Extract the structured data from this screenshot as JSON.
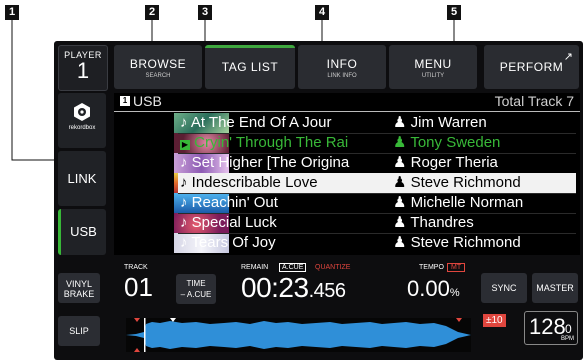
{
  "callouts": [
    "1",
    "2",
    "3",
    "4",
    "5"
  ],
  "player": {
    "label": "PLAYER",
    "number": "1"
  },
  "tabs": [
    {
      "label": "BROWSE",
      "sub": "SEARCH"
    },
    {
      "label": "TAG LIST",
      "sub": ""
    },
    {
      "label": "INFO",
      "sub": "LINK INFO"
    },
    {
      "label": "MENU",
      "sub": "UTILITY"
    }
  ],
  "perform_label": "PERFORM",
  "sources": {
    "rekordbox": "rekordbox",
    "link": "LINK",
    "usb": "USB"
  },
  "list": {
    "source_badge": "1",
    "source": "USB",
    "total": "Total Track 7",
    "rows": [
      {
        "title": "At The End Of A Jour",
        "artist": "Jim Warren",
        "state": "normal"
      },
      {
        "title": "Cryin' Through The Rai",
        "artist": "Tony Sweden",
        "state": "green"
      },
      {
        "title": "Set Higher [The Origina",
        "artist": "Roger Theria",
        "state": "normal"
      },
      {
        "title": "Indescribable Love",
        "artist": "Steve Richmond",
        "state": "selected"
      },
      {
        "title": "Reachin' Out",
        "artist": "Michelle Norman",
        "state": "normal"
      },
      {
        "title": "Special Luck",
        "artist": "Thandres",
        "state": "normal"
      },
      {
        "title": "Tears Of Joy",
        "artist": "Steve Richmond",
        "state": "normal"
      }
    ]
  },
  "left_buttons": {
    "vinyl": "VINYL BRAKE",
    "slip": "SLIP"
  },
  "deck": {
    "track_label": "TRACK",
    "track": "01",
    "time_label": "TIME",
    "time_sub": "– A.CUE",
    "remain_label": "REMAIN",
    "acue_label": "A.CUE",
    "quantize_label": "QUANTIZE",
    "time_main": "00:23",
    "time_frac": ".456",
    "tempo_label": "TEMPO",
    "mt_label": "MT",
    "tempo_value": "0.00",
    "tempo_unit": "%"
  },
  "right_buttons": {
    "sync": "SYNC",
    "master": "MASTER",
    "range": "±10",
    "bpm": "128",
    "bpm_dec": "0",
    "bpm_label": "BPM"
  },
  "colors": {
    "accent_green": "#38b838",
    "quantize_red": "#e0463e",
    "waveform": "#2f8fd8"
  }
}
